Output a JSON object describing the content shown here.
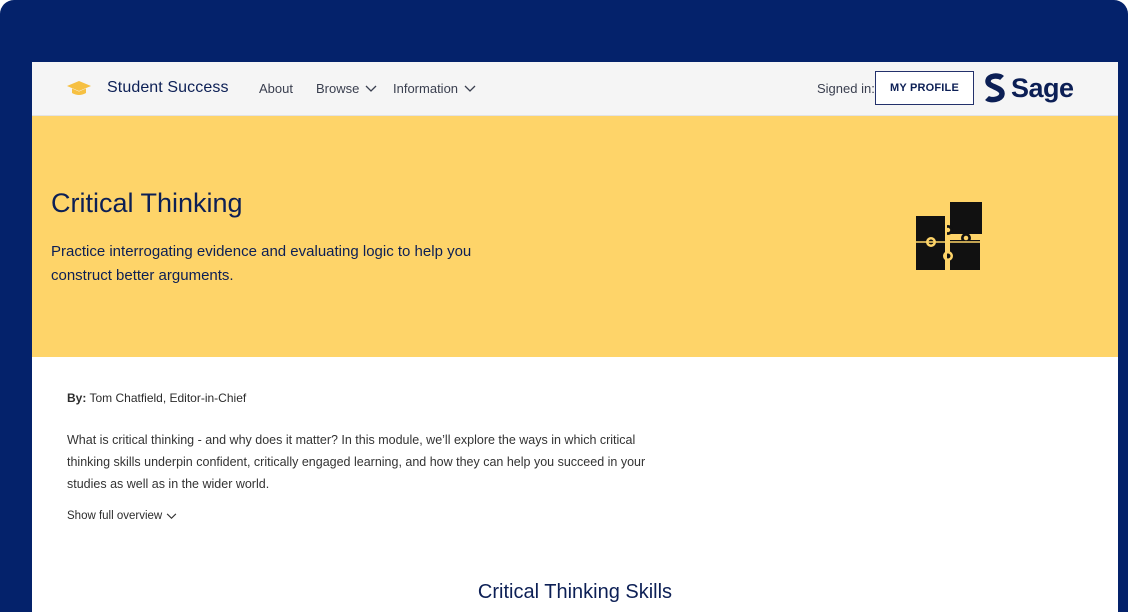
{
  "header": {
    "brand_name": "Student Success",
    "brand_icon": "graduation-cap-icon",
    "nav": [
      {
        "label": "About",
        "has_dropdown": false
      },
      {
        "label": "Browse",
        "has_dropdown": true
      },
      {
        "label": "Information",
        "has_dropdown": true
      }
    ],
    "signed_in_label": "Signed in:",
    "profile_button": "MY PROFILE",
    "logo_text": "Sage"
  },
  "hero": {
    "title": "Critical Thinking",
    "description": "Practice interrogating evidence and evaluating logic to help you construct better arguments.",
    "icon": "puzzle-pieces-icon",
    "background": "#fed469"
  },
  "content": {
    "byline_label": "By:",
    "byline_name": "Tom Chatfield, Editor-in-Chief",
    "overview": "What is critical thinking - and why does it matter? In this module, we’ll explore the ways in which critical thinking skills underpin confident, critically engaged learning, and how they can help you succeed in your studies as well as in the wider world.",
    "show_more": "Show full overview",
    "section_title": "Critical Thinking Skills"
  },
  "colors": {
    "frame": "#04226b",
    "navy_text": "#0c1f55",
    "accent_yellow": "#fed469",
    "cap_yellow": "#f6c042"
  }
}
